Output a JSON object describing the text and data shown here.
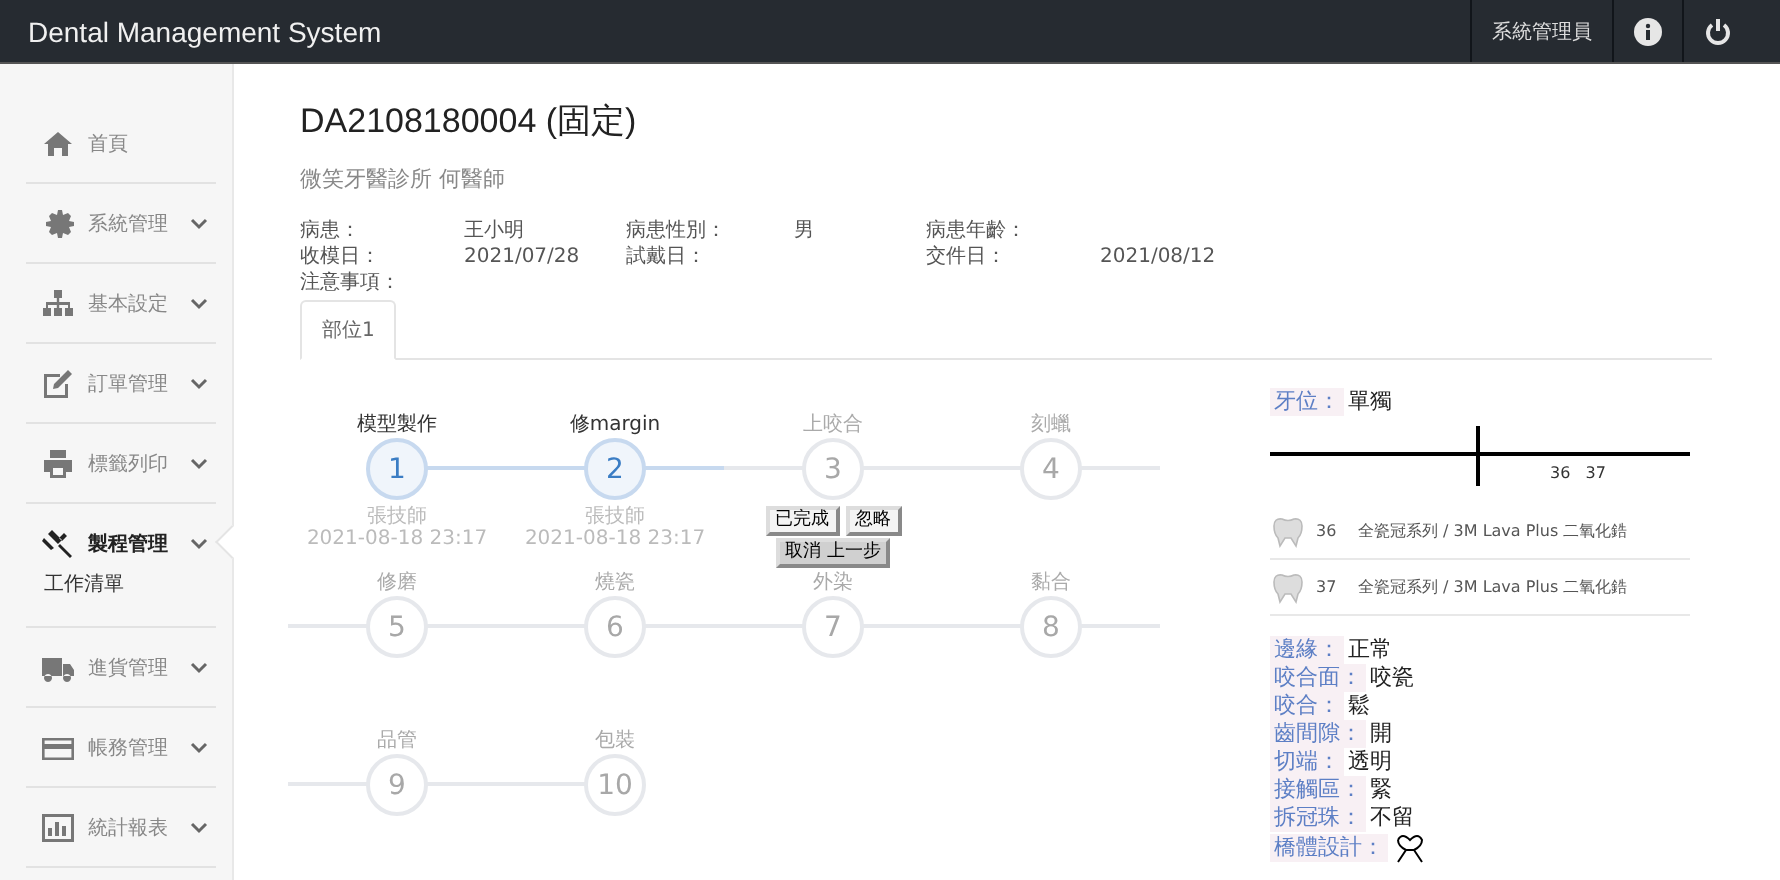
{
  "header": {
    "title": "Dental Management System",
    "user": "系統管理員"
  },
  "sidebar": {
    "items": [
      {
        "label": "首頁",
        "expandable": false,
        "selected": false
      },
      {
        "label": "系統管理",
        "expandable": true,
        "selected": false
      },
      {
        "label": "基本設定",
        "expandable": true,
        "selected": false
      },
      {
        "label": "訂單管理",
        "expandable": true,
        "selected": false
      },
      {
        "label": "標籤列印",
        "expandable": true,
        "selected": false
      },
      {
        "label": "製程管理",
        "expandable": true,
        "selected": true,
        "children": [
          {
            "label": "工作清單"
          }
        ]
      },
      {
        "label": "進貨管理",
        "expandable": true,
        "selected": false
      },
      {
        "label": "帳務管理",
        "expandable": true,
        "selected": false
      },
      {
        "label": "統計報表",
        "expandable": true,
        "selected": false
      }
    ]
  },
  "order": {
    "title": "DA2108180004 (固定)",
    "clinic": "微笑牙醫診所 何醫師",
    "fields": [
      {
        "label": "病患：",
        "value": "王小明"
      },
      {
        "label": "病患性別：",
        "value": "男"
      },
      {
        "label": "病患年齡："
      },
      {
        "label": "收模日：",
        "value": "2021/07/28"
      },
      {
        "label": "試戴日："
      },
      {
        "label": "交件日：",
        "value": "2021/08/12"
      },
      {
        "label": "注意事項："
      }
    ]
  },
  "tabs": [
    {
      "label": "部位1",
      "selected": true
    }
  ],
  "steps": [
    {
      "label": "模型製作",
      "number": "1",
      "done": true,
      "technician": "張技師",
      "time": "2021-08-18 23:17"
    },
    {
      "label": "修margin",
      "number": "2",
      "done": true,
      "technician": "張技師",
      "time": "2021-08-18 23:17"
    },
    {
      "label": "上咬合",
      "number": "3",
      "done": false,
      "actions": [
        "已完成",
        "忽略",
        "取消 上一步"
      ]
    },
    {
      "label": "刻蠟",
      "number": "4",
      "done": false
    },
    {
      "label": "修磨",
      "number": "5",
      "done": false
    },
    {
      "label": "燒瓷",
      "number": "6",
      "done": false
    },
    {
      "label": "外染",
      "number": "7",
      "done": false
    },
    {
      "label": "黏合",
      "number": "8",
      "done": false
    },
    {
      "label": "品管",
      "number": "9",
      "done": false
    },
    {
      "label": "包裝",
      "number": "10",
      "done": false
    }
  ],
  "tooth_position": {
    "label": "牙位：",
    "value": "單獨",
    "chart_teeth": "36   37"
  },
  "products": [
    {
      "tooth": "36",
      "name": "全瓷冠系列 / 3M Lava Plus 二氧化鋯"
    },
    {
      "tooth": "37",
      "name": "全瓷冠系列 / 3M Lava Plus 二氧化鋯"
    }
  ],
  "properties": [
    {
      "label": "邊緣：",
      "value": "正常",
      "kind": "text"
    },
    {
      "label": "咬合面：",
      "value": "咬瓷",
      "kind": "text"
    },
    {
      "label": "咬合：",
      "value": "鬆",
      "kind": "text"
    },
    {
      "label": "齒間隙：",
      "value": "開",
      "kind": "text"
    },
    {
      "label": "切端：",
      "value": "透明",
      "kind": "text"
    },
    {
      "label": "接觸區：",
      "value": "緊",
      "kind": "text"
    },
    {
      "label": "拆冠珠：",
      "value": "不留",
      "kind": "text"
    },
    {
      "label": "橋體設計：",
      "kind": "icon"
    }
  ]
}
